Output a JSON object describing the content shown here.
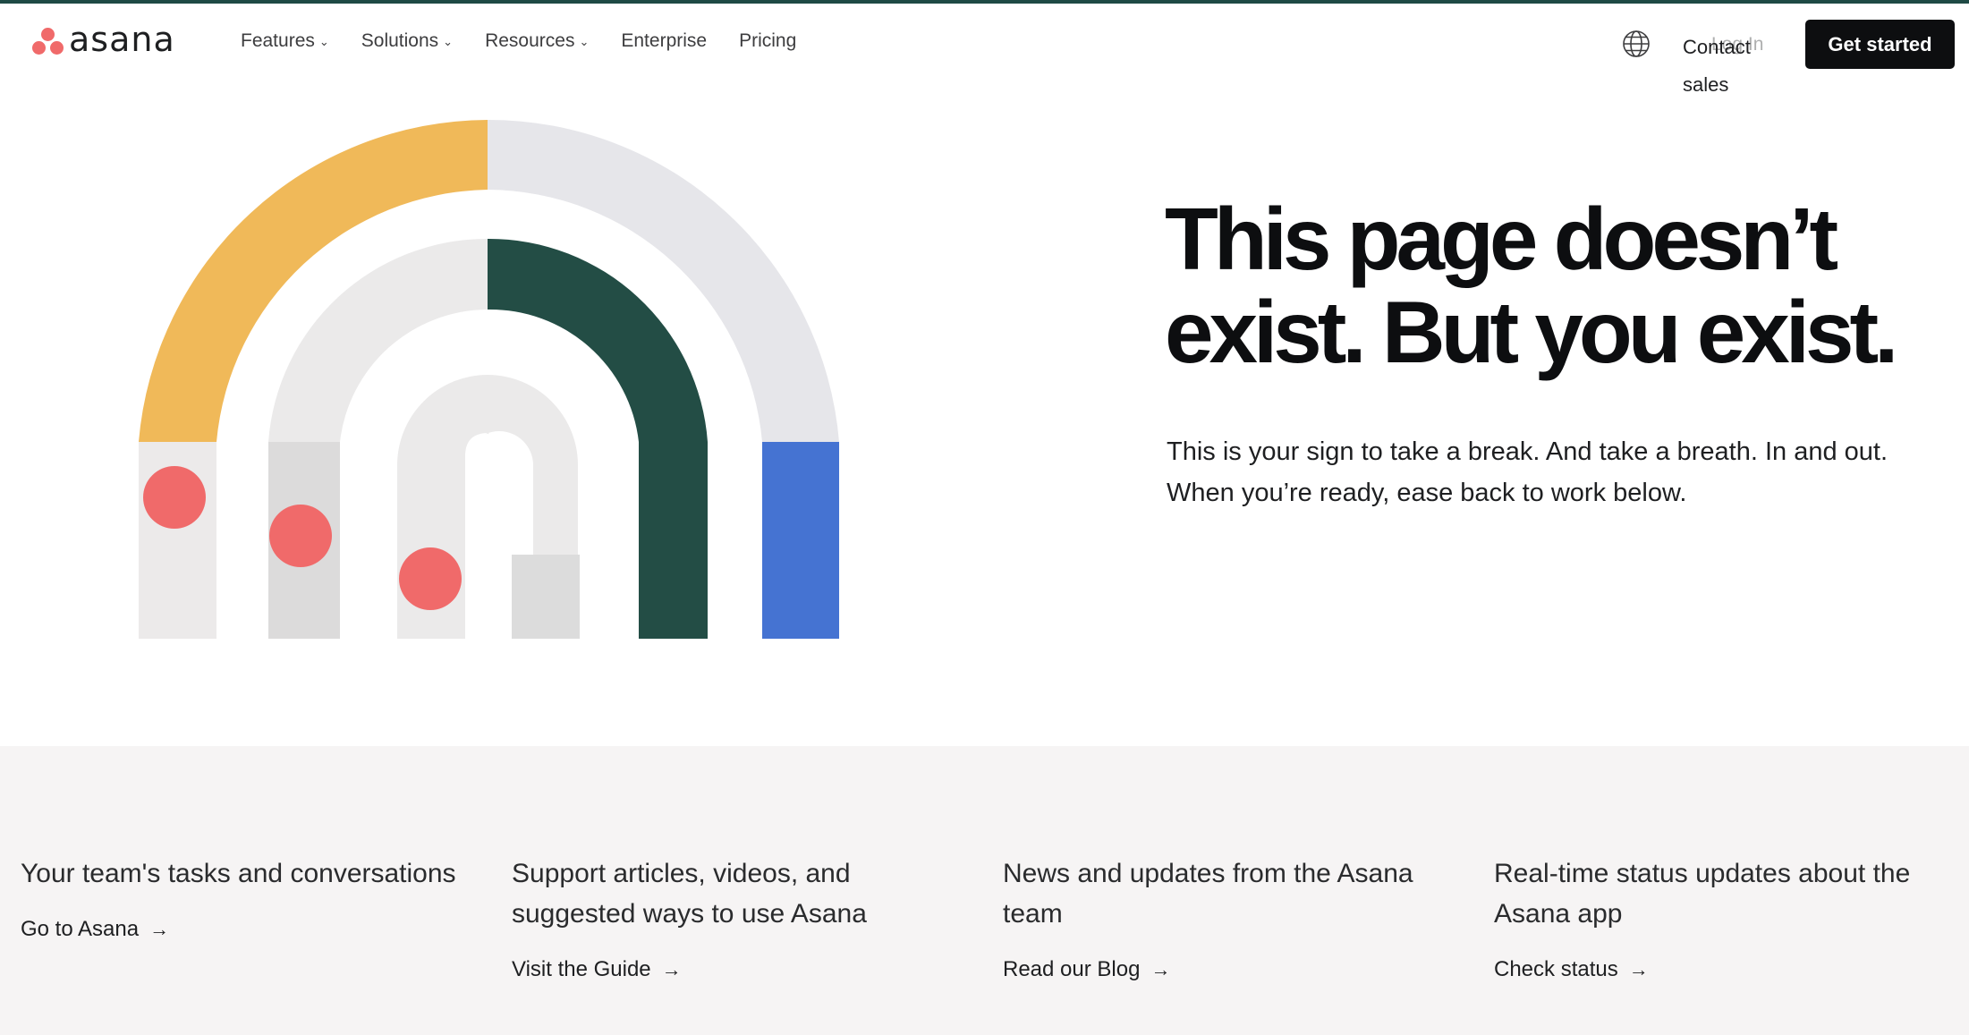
{
  "brand": {
    "name": "asana",
    "dot_color": "#f06a6a"
  },
  "nav": {
    "items": [
      {
        "label": "Features",
        "has_dropdown": true
      },
      {
        "label": "Solutions",
        "has_dropdown": true
      },
      {
        "label": "Resources",
        "has_dropdown": true
      },
      {
        "label": "Enterprise",
        "has_dropdown": false
      },
      {
        "label": "Pricing",
        "has_dropdown": false
      }
    ],
    "dropdown_icon": "chevron-down-icon",
    "globe_icon": "globe-icon",
    "contact_label": "Contact sales",
    "login_label": "Log In",
    "cta_label": "Get started"
  },
  "hero": {
    "title": "This page doesn’t exist. But you exist.",
    "subtitle": "This is your sign to take a break. And take a breath. In and out. When you’re ready, ease back to work below."
  },
  "links": [
    {
      "text": "Your team's tasks and conversations",
      "link_label": "Go to Asana"
    },
    {
      "text": "Support articles, videos, and suggested ways to use Asana",
      "link_label": "Visit the Guide"
    },
    {
      "text": "News and updates from the Asana team",
      "link_label": "Read our Blog"
    },
    {
      "text": "Real-time status updates about the Asana app",
      "link_label": "Check status"
    }
  ],
  "colors": {
    "accent_dark": "#1f4a45",
    "cta_bg": "#0d0e10",
    "footer_bg": "#f6f4f4",
    "illustration_yellow": "#f0b959",
    "illustration_green": "#234d45",
    "illustration_blue": "#4573d2",
    "illustration_red": "#f06a6a"
  }
}
